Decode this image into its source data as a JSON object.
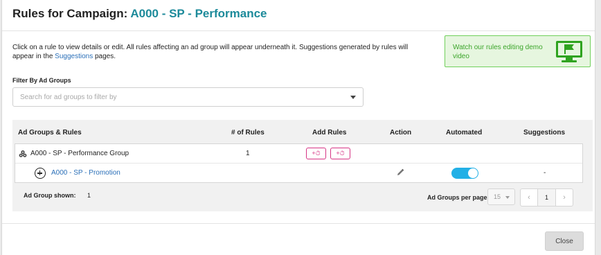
{
  "header": {
    "title_prefix": "Rules for Campaign: ",
    "campaign_name": "A000 - SP - Performance"
  },
  "intro": {
    "text_before_link": "Click on a rule to view details or edit. All rules affecting an ad group will appear underneath it. Suggestions generated by rules will appear in the ",
    "link_text": "Suggestions",
    "text_after_link": " pages."
  },
  "demo": {
    "text": "Watch our rules editing demo video",
    "icon": "monitor-flag-icon",
    "color": "#3ba52a"
  },
  "filter": {
    "label": "Filter By Ad Groups",
    "placeholder": "Search for ad groups to filter by",
    "value": ""
  },
  "table": {
    "headers": {
      "ad_groups": "Ad Groups & Rules",
      "num_rules": "# of Rules",
      "add_rules": "Add Rules",
      "action": "Action",
      "automated": "Automated",
      "suggestions": "Suggestions"
    },
    "group": {
      "icon": "ad-group-icon",
      "name": "A000 - SP - Performance Group",
      "num_rules": "1",
      "add_rule_buttons": [
        "+⏱",
        "+⏱"
      ]
    },
    "rule": {
      "name": "A000 - SP - Promotion",
      "action_icon": "pencil-icon",
      "automated": true,
      "suggestions": "-"
    }
  },
  "footer_bar": {
    "shown_label": "Ad Group shown:",
    "shown_value": "1",
    "per_page_label": "Ad Groups per page",
    "per_page_value": "15",
    "pager": {
      "prev": "‹",
      "current": "1",
      "next": "›"
    }
  },
  "actions": {
    "close_label": "Close"
  },
  "colors": {
    "accent": "#1c8a9a",
    "link": "#2a6fb8",
    "add_rule": "#d63384",
    "toggle_on": "#23b0e6"
  }
}
